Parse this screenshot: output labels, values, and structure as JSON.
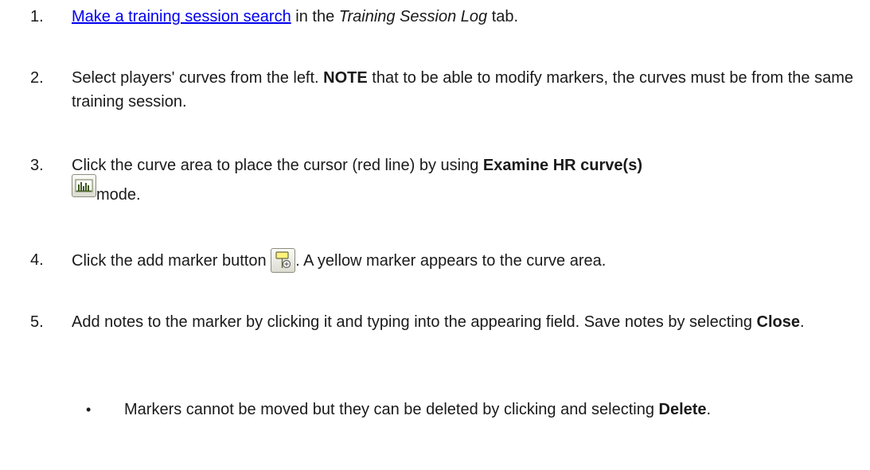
{
  "steps": [
    {
      "number": "1.",
      "link": "Make a training session search",
      "t1": " in the ",
      "em": "Training Session Log",
      "t2": " tab."
    },
    {
      "number": "2.",
      "t1": "Select players' curves from the left. ",
      "strong": "NOTE",
      "t2": " that to be able to modify markers, the curves must be from the same training session."
    },
    {
      "number": "3.",
      "t1": "Click the curve area to place the cursor (red line) by using ",
      "strong": "Examine HR curve(s)",
      "icon": "examine-hr-curve-icon",
      "t2": "mode."
    },
    {
      "number": "4.",
      "t1": "Click the add marker button ",
      "icon": "add-marker-icon",
      "t2": ". A yellow marker appears to the curve area."
    },
    {
      "number": "5.",
      "t1": "Add notes to the marker by clicking it and typing into the appearing field. Save notes by selecting ",
      "strong": "Close",
      "t2": "."
    }
  ],
  "bullets": [
    {
      "t1": "Markers cannot be moved but they can be deleted by clicking and selecting ",
      "strong": "Delete",
      "t2": "."
    }
  ],
  "colors": {
    "link": "#0000ee",
    "text": "#1a1a1a"
  }
}
